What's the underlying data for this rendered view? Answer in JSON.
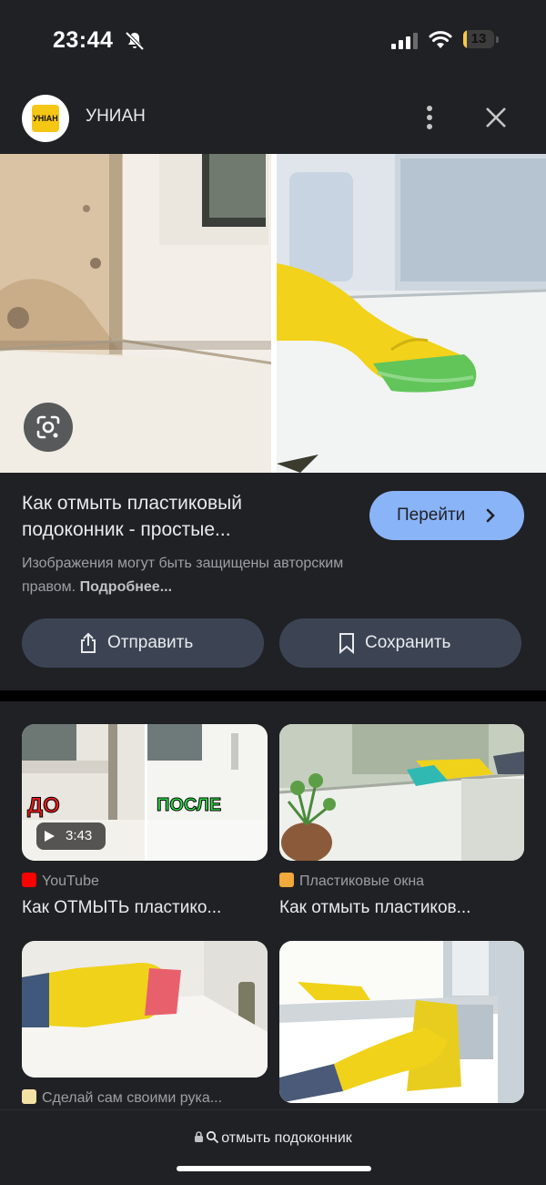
{
  "status_bar": {
    "time": "23:44",
    "battery_level": "13",
    "battery_fraction": 0.13
  },
  "source": {
    "logo_text": "УНIАН",
    "name": "УНИАН"
  },
  "result": {
    "title_line1": "Как отмыть пластиковый",
    "title_line2": "подоконник - простые...",
    "go_label": "Перейти",
    "copyright_line1": "Изображения могут быть защищены авторским",
    "copyright_line2": "правом.",
    "more_link": "Подробнее..."
  },
  "actions": {
    "share_label": "Отправить",
    "save_label": "Сохранить"
  },
  "related": [
    {
      "source": "YouTube",
      "title": "Как ОТМЫТЬ пластико...",
      "duration": "3:43",
      "overlay_before": "ДО",
      "overlay_after": "ПОСЛЕ"
    },
    {
      "source": "Пластиковые окна",
      "title": "Как отмыть пластиков..."
    },
    {
      "source": "Сделай сам своими рука...",
      "title": ""
    },
    {
      "source": "",
      "title": ""
    }
  ],
  "search": {
    "query": "отмыть подоконник"
  },
  "colors": {
    "accent": "#8ab4f8",
    "background": "#202124",
    "pill": "#3c4454",
    "glove": "#f2d21b"
  },
  "icons": [
    "bell-off-icon",
    "signal-icon",
    "wifi-icon",
    "battery-icon",
    "more-vert-icon",
    "close-icon",
    "lens-icon",
    "chevron-right-icon",
    "share-icon",
    "bookmark-icon",
    "youtube-icon",
    "play-icon",
    "lock-icon",
    "search-icon"
  ]
}
